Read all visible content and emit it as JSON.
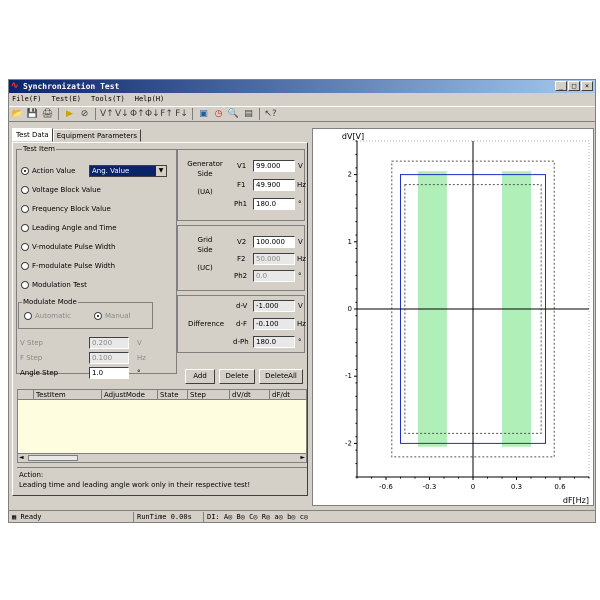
{
  "window": {
    "title": "Synchronization Test",
    "min": "_",
    "max": "□",
    "close": "×"
  },
  "menu": [
    "File(F)",
    "Test(E)",
    "Tools(T)",
    "Help(H)"
  ],
  "toolbar": [
    {
      "icon": "open-folder-icon",
      "glyph": "📂"
    },
    {
      "icon": "save-icon",
      "glyph": "💾"
    },
    {
      "icon": "print-icon",
      "glyph": "🖨"
    },
    {
      "icon": "play-icon",
      "glyph": "▶"
    },
    {
      "icon": "stop-icon",
      "glyph": "⊘"
    },
    {
      "icon": "v1-icon",
      "glyph": "V↑"
    },
    {
      "icon": "v2-icon",
      "glyph": "V↓"
    },
    {
      "icon": "phase-up-icon",
      "glyph": "Φ↑"
    },
    {
      "icon": "phase-down-icon",
      "glyph": "Φ↓"
    },
    {
      "icon": "f-up-icon",
      "glyph": "F↑"
    },
    {
      "icon": "f-down-icon",
      "glyph": "F↓"
    },
    {
      "icon": "monitor-icon",
      "glyph": "▣"
    },
    {
      "icon": "clock-icon",
      "glyph": "◷"
    },
    {
      "icon": "zoom-icon",
      "glyph": "🔍"
    },
    {
      "icon": "report-icon",
      "glyph": "▤"
    },
    {
      "icon": "help-pointer-icon",
      "glyph": "↖?"
    }
  ],
  "tabs": [
    "Test Data",
    "Equipment Parameters"
  ],
  "test_item": {
    "title": "Test Item",
    "options": [
      "Action Value",
      "Voltage Block Value",
      "Frequency Block Value",
      "Leading Angle and Time",
      "V-modulate Pulse Width",
      "F-modulate Pulse Width",
      "Modulation Test"
    ],
    "selected_index": 0,
    "action_select": "Ang. Value"
  },
  "modulate_mode": {
    "title": "Modulate Mode",
    "automatic": "Automatic",
    "manual": "Manual"
  },
  "steps": {
    "v_step_label": "V Step",
    "v_step_value": "0.200",
    "v_step_unit": "V",
    "f_step_label": "F Step",
    "f_step_value": "0.100",
    "f_step_unit": "Hz",
    "angle_step_label": "Angle Step",
    "angle_step_value": "1.0",
    "angle_step_unit": "°"
  },
  "generator": {
    "title_line1": "Generator",
    "title_line2": "Side",
    "title_line3": "(UA)",
    "v_label": "V1",
    "v_value": "99.000",
    "v_unit": "V",
    "f_label": "F1",
    "f_value": "49.900",
    "f_unit": "Hz",
    "ph_label": "Ph1",
    "ph_value": "180.0",
    "ph_unit": "°"
  },
  "grid": {
    "title_line1": "Grid",
    "title_line2": "Side",
    "title_line3": "(UC)",
    "v_label": "V2",
    "v_value": "100.000",
    "v_unit": "V",
    "f_label": "F2",
    "f_value": "50.000",
    "f_unit": "Hz",
    "ph_label": "Ph2",
    "ph_value": "0.0",
    "ph_unit": "°"
  },
  "difference": {
    "title": "Difference",
    "dv_label": "d-V",
    "dv_value": "-1.000",
    "dv_unit": "V",
    "df_label": "d-F",
    "df_value": "-0.100",
    "df_unit": "Hz",
    "dph_label": "d-Ph",
    "dph_value": "180.0",
    "dph_unit": "°"
  },
  "buttons": {
    "add": "Add",
    "delete": "Delete",
    "delete_all": "DeleteAll"
  },
  "table": {
    "columns": [
      "TestItem",
      "AdjustMode",
      "State",
      "Step",
      "dV/dt",
      "dF/dt"
    ]
  },
  "action_info": {
    "title": "Action:",
    "text": "Leading time and leading angle work only in their respective test!"
  },
  "statusbar": {
    "ready": "Ready",
    "runtime": "RunTime 0.00s",
    "di": "DI: A◎ B◎ C◎ R◎ a◎ b◎ c◎"
  },
  "chart_data": {
    "type": "scatter",
    "xlabel": "dF[Hz]",
    "ylabel": "dV[V]",
    "xlim": [
      -0.8,
      0.8
    ],
    "ylim": [
      -2.5,
      2.5
    ],
    "xticks": [
      -0.6,
      -0.3,
      0,
      0.3,
      0.6
    ],
    "xtick_labels": [
      "-0.6",
      "-0.3",
      "0",
      "0.3",
      "0.6"
    ],
    "yticks": [
      -2,
      -1,
      0,
      1,
      2
    ],
    "ytick_labels": [
      "-2",
      "-1",
      "0",
      "1",
      "2"
    ],
    "regions": [
      {
        "name": "action-band-left",
        "x": [
          -0.38,
          -0.18
        ],
        "y": [
          -2.05,
          2.05
        ],
        "color": "#b0f0b8"
      },
      {
        "name": "action-band-right",
        "x": [
          0.2,
          0.4
        ],
        "y": [
          -2.05,
          2.05
        ],
        "color": "#b0f0b8"
      }
    ],
    "outlines": [
      {
        "name": "blue-limit-box",
        "x": [
          -0.5,
          0.5
        ],
        "y": [
          -2,
          2
        ],
        "color": "#2030c0",
        "style": "solid"
      },
      {
        "name": "inner-dashed-box",
        "x": [
          -0.47,
          0.47
        ],
        "y": [
          -1.85,
          1.85
        ],
        "color": "#555555",
        "style": "dashed"
      },
      {
        "name": "outer-dashed-box",
        "x": [
          -0.56,
          0.56
        ],
        "y": [
          -2.2,
          2.2
        ],
        "color": "#555555",
        "style": "dashed"
      }
    ],
    "grid": false
  }
}
